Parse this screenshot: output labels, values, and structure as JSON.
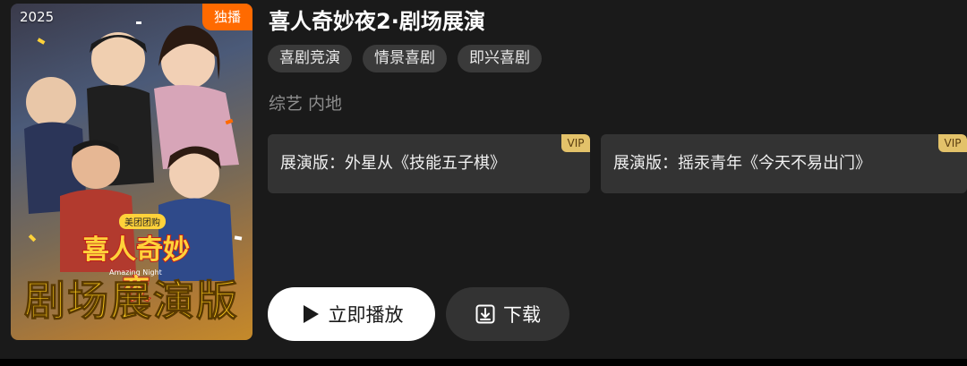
{
  "poster": {
    "year": "2025",
    "badge": "独播",
    "logo_text": "喜人奇妙夜",
    "sponsor": "美团团购",
    "subtitle": "Amazing Night",
    "bottom_text": "剧场展演版"
  },
  "show": {
    "title": "喜人奇妙夜2·剧场展演",
    "tags": [
      "喜剧竞演",
      "情景喜剧",
      "即兴喜剧"
    ],
    "meta": "综艺 内地"
  },
  "episodes": [
    {
      "label": "展演版：外星从《技能五子棋》",
      "badge": "VIP"
    },
    {
      "label": "展演版：摇汞青年《今天不易出门》",
      "badge": "VIP"
    }
  ],
  "actions": {
    "play_label": "立即播放",
    "download_label": "下载"
  },
  "colors": {
    "background": "#1a1a1a",
    "badge_orange": "#ff6a00",
    "vip_gold": "#e3c26a",
    "tag_bg": "#3a3a3a"
  },
  "icons": {
    "play": "play-icon",
    "download": "download-icon"
  }
}
